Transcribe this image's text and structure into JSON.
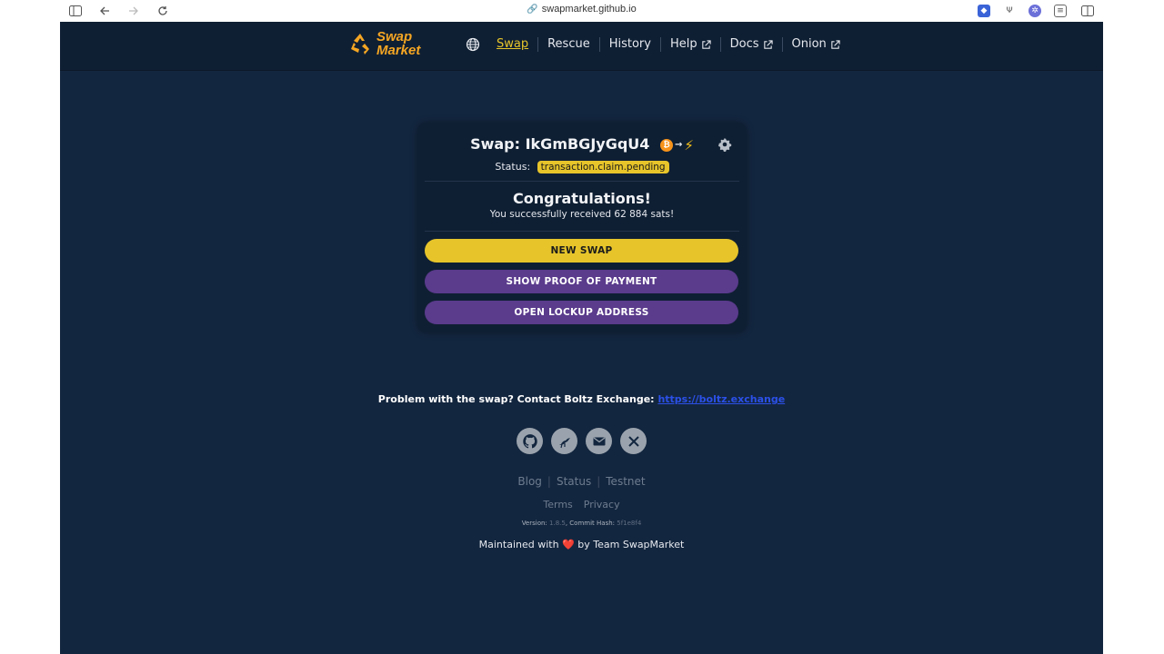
{
  "browser": {
    "url": "swapmarket.github.io"
  },
  "nav": {
    "logo_line1": "Swap",
    "logo_line2": "Market",
    "items": [
      {
        "label": "Swap",
        "active": true,
        "external": false
      },
      {
        "label": "Rescue",
        "active": false,
        "external": false
      },
      {
        "label": "History",
        "active": false,
        "external": false
      },
      {
        "label": "Help",
        "active": false,
        "external": true
      },
      {
        "label": "Docs",
        "active": false,
        "external": true
      },
      {
        "label": "Onion",
        "active": false,
        "external": true
      }
    ]
  },
  "swap": {
    "title": "Swap: IkGmBGJyGqU4",
    "status_label": "Status:",
    "status_value": "transaction.claim.pending",
    "congrats_title": "Congratulations!",
    "congrats_message": "You successfully received 62 884 sats!",
    "buttons": {
      "new_swap": "NEW SWAP",
      "proof": "SHOW PROOF OF PAYMENT",
      "lockup": "OPEN LOCKUP ADDRESS"
    }
  },
  "footer": {
    "problem_text": "Problem with the swap? Contact Boltz Exchange:",
    "problem_link": "https://boltz.exchange",
    "links": [
      "Blog",
      "Status",
      "Testnet"
    ],
    "links2": [
      "Terms",
      "Privacy"
    ],
    "version_label": "Version:",
    "version_value": "1.8.5",
    "commit_label": ", Commit Hash:",
    "commit_value": "5f1e8f4",
    "maintained_prefix": "Maintained with",
    "maintained_heart": "❤️",
    "maintained_suffix": "by Team SwapMarket"
  },
  "colors": {
    "page_bg": "#13263f",
    "card_bg": "#0f1f33",
    "accent_yellow": "#e7c52a",
    "accent_purple": "#5a3b8c"
  }
}
